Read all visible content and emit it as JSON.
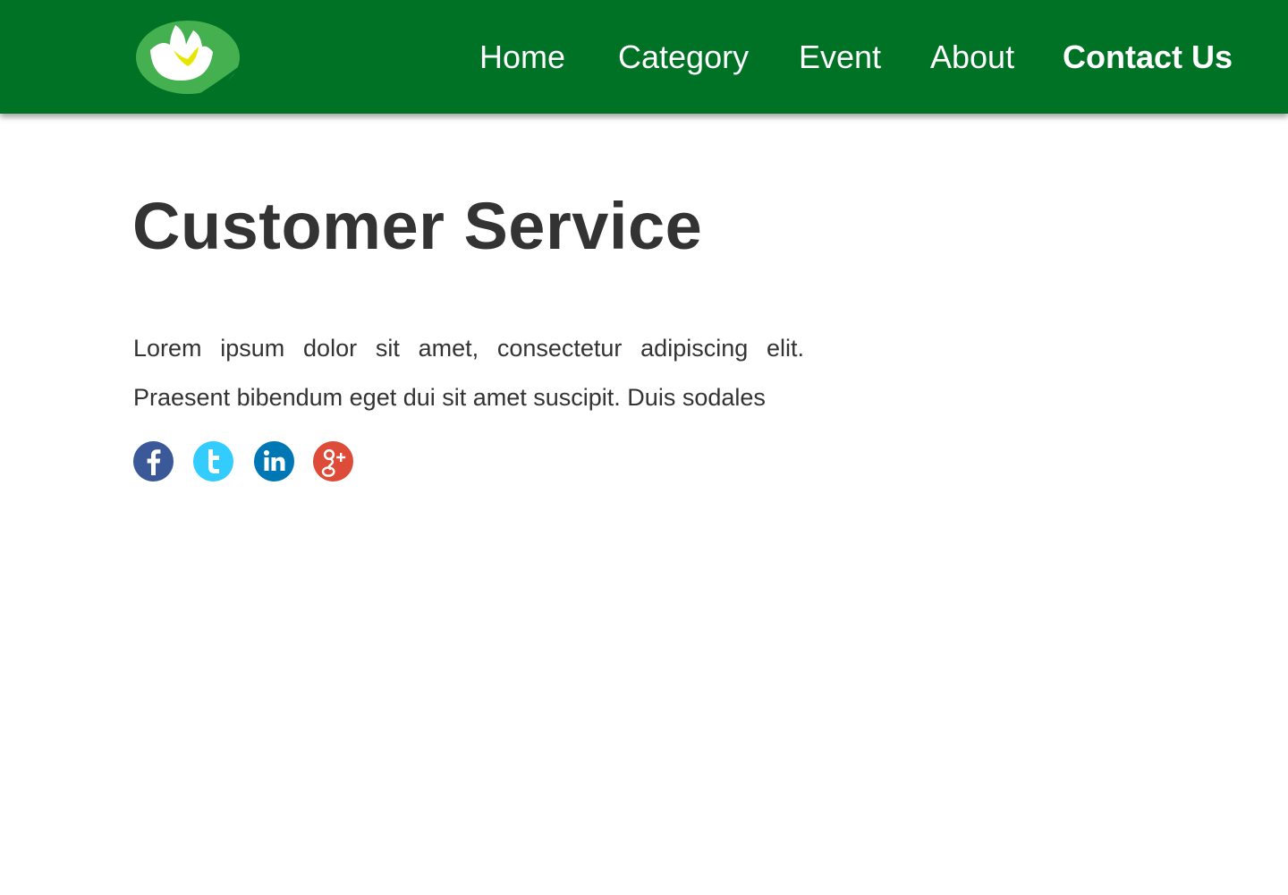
{
  "header": {
    "logo_icon": "water-lily-logo-icon",
    "brand_color": "#007226",
    "nav": {
      "home": "Home",
      "category": "Category",
      "event": "Event",
      "about": "About",
      "contact": "Contact Us"
    },
    "active_nav": "contact"
  },
  "main": {
    "title": "Customer Service",
    "paragraph": "Lorem ipsum dolor sit amet, consectetur adipiscing elit. Praesent bibendum eget dui sit amet suscipit. Duis sodales",
    "social": [
      {
        "icon": "facebook-icon",
        "color": "#3b5998"
      },
      {
        "icon": "twitter-icon",
        "color": "#33ccff"
      },
      {
        "icon": "linkedin-icon",
        "color": "#0077b5"
      },
      {
        "icon": "google-plus-icon",
        "color": "#dd4b39"
      }
    ]
  }
}
